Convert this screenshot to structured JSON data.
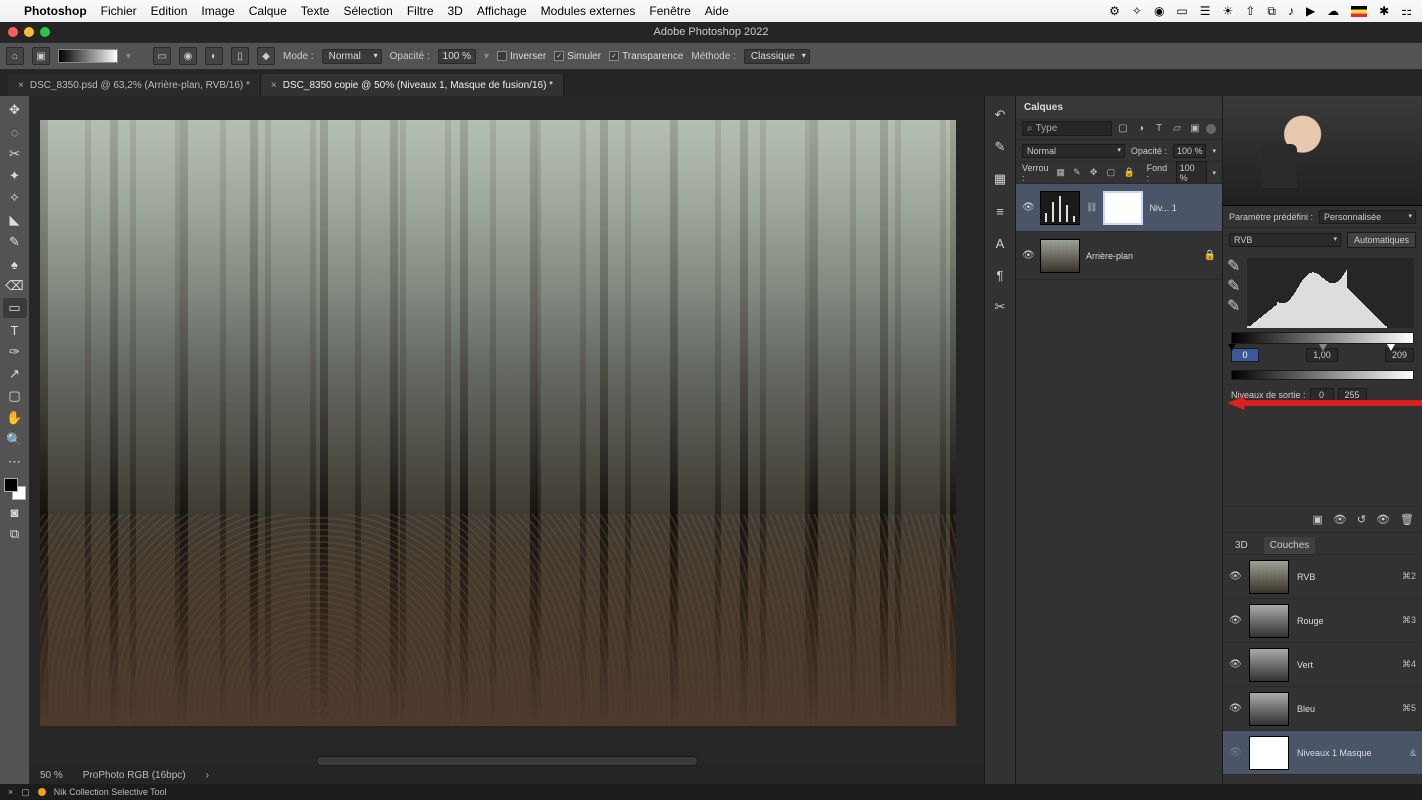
{
  "menubar": {
    "app": "Photoshop",
    "items": [
      "Fichier",
      "Edition",
      "Image",
      "Calque",
      "Texte",
      "Sélection",
      "Filtre",
      "3D",
      "Affichage",
      "Modules externes",
      "Fenêtre",
      "Aide"
    ]
  },
  "window": {
    "title": "Adobe Photoshop 2022"
  },
  "optionsbar": {
    "mode_label": "Mode :",
    "mode_value": "Normal",
    "opacity_label": "Opacité :",
    "opacity_value": "100 %",
    "inverse": "Inverser",
    "simulate": "Simuler",
    "transparency": "Transparence",
    "method_label": "Méthode :",
    "method_value": "Classique"
  },
  "tabs": [
    {
      "label": "DSC_8350.psd @ 63,2% (Arrière-plan, RVB/16) *",
      "active": false
    },
    {
      "label": "DSC_8350 copie @ 50% (Niveaux 1, Masque de fusion/16) *",
      "active": true
    }
  ],
  "status": {
    "zoom": "50 %",
    "profile": "ProPhoto RGB (16bpc)"
  },
  "layers_panel": {
    "title": "Calques",
    "filter_type": "Type",
    "blend_mode": "Normal",
    "opacity_label": "Opacité :",
    "opacity_value": "100 %",
    "lock_label": "Verrou :",
    "fill_label": "Fond :",
    "fill_value": "100 %",
    "layers": [
      {
        "name": "Niv... 1",
        "selected": true
      },
      {
        "name": "Arrière-plan",
        "selected": false,
        "locked": true
      }
    ]
  },
  "properties": {
    "preset_label": "Paramètre prédéfini :",
    "preset_value": "Personnalisée",
    "channel": "RVB",
    "auto_btn": "Automatiques",
    "input_levels": {
      "shadow": "0",
      "mid": "1,00",
      "high": "209"
    },
    "output_label": "Niveaux de sortie :",
    "output_levels": {
      "low": "0",
      "high": "255"
    }
  },
  "channels": {
    "tab_3d": "3D",
    "tab_channels": "Couches",
    "items": [
      {
        "name": "RVB",
        "shortcut": "⌘2",
        "color": true
      },
      {
        "name": "Rouge",
        "shortcut": "⌘3",
        "color": false
      },
      {
        "name": "Vert",
        "shortcut": "⌘4",
        "color": false
      },
      {
        "name": "Bleu",
        "shortcut": "⌘5",
        "color": false
      },
      {
        "name": "Niveaux 1 Masque",
        "shortcut": "&",
        "mask": true,
        "selected": true
      }
    ]
  },
  "bottom": {
    "tool": "Nik Collection Selective Tool"
  }
}
